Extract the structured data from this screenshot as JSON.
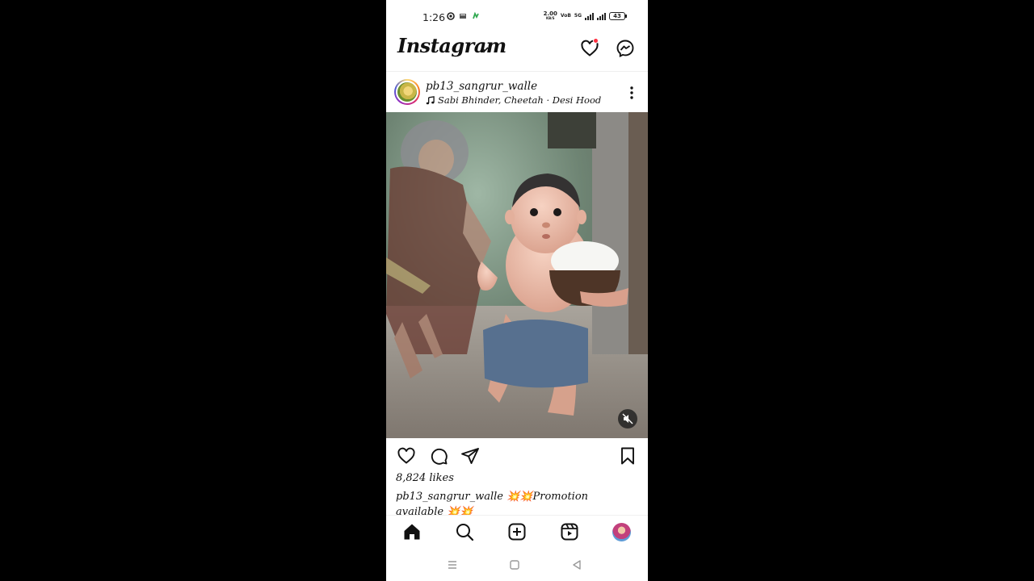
{
  "status_bar": {
    "time": "1:26",
    "net_speed_value": "2.00",
    "net_speed_unit": "KB/S",
    "volte": "VoB",
    "sim": "5G",
    "battery": "43"
  },
  "header": {
    "brand": "Instagram"
  },
  "post": {
    "username": "pb13_sangrur_walle",
    "music": "Sabi Bhinder, Cheetah · Desi Hood",
    "likes": "8,824 likes",
    "caption_user": "pb13_sangrur_walle",
    "caption_text": "💥💥Promotion available 💥💥"
  },
  "colors": {
    "notification_dot": "#ff3040",
    "text": "#111111",
    "background": "#ffffff"
  },
  "icons": {
    "header": [
      "heart-icon",
      "messenger-icon"
    ],
    "post_actions": [
      "like-icon",
      "comment-icon",
      "share-icon",
      "bookmark-icon"
    ],
    "bottom_nav": [
      "home-icon",
      "search-icon",
      "create-icon",
      "reels-icon",
      "profile-avatar"
    ]
  }
}
